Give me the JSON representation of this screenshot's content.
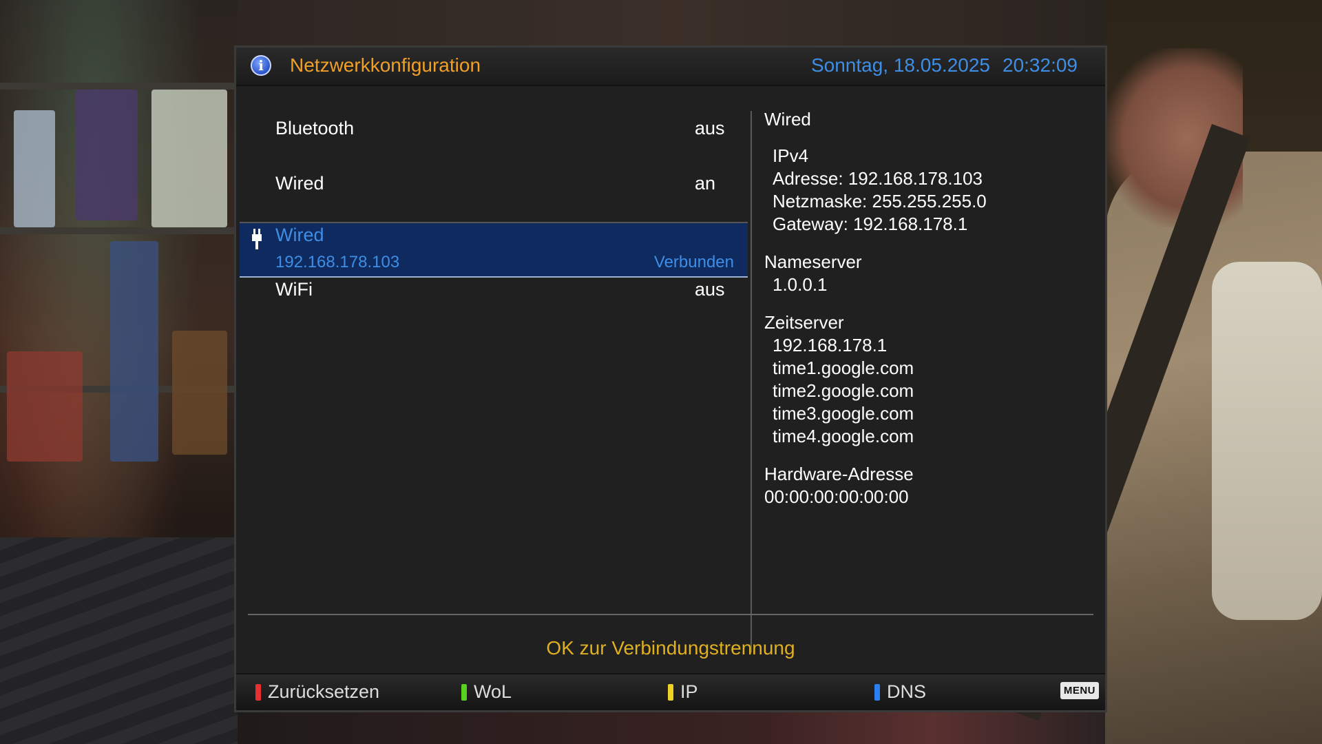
{
  "header": {
    "title": "Netzwerkkonfiguration",
    "date": "Sonntag, 18.05.2025",
    "time": "20:32:09",
    "info_icon": "info-icon"
  },
  "interfaces": {
    "bluetooth": {
      "label": "Bluetooth",
      "state": "aus"
    },
    "wired_toggle": {
      "label": "Wired",
      "state": "an"
    },
    "wired_connection": {
      "label": "Wired",
      "ip": "192.168.178.103",
      "status": "Verbunden",
      "icon": "ethernet-plug-icon"
    },
    "wifi": {
      "label": "WiFi",
      "state": "aus"
    }
  },
  "details": {
    "title": "Wired",
    "ipv4_heading": "IPv4",
    "address": "Adresse: 192.168.178.103",
    "netmask": "Netzmaske: 255.255.255.0",
    "gateway": "Gateway: 192.168.178.1",
    "nameserver_heading": "Nameserver",
    "nameservers": [
      "1.0.0.1"
    ],
    "timeserver_heading": "Zeitserver",
    "timeservers": [
      "192.168.178.1",
      "time1.google.com",
      "time2.google.com",
      "time3.google.com",
      "time4.google.com"
    ],
    "hw_heading": "Hardware-Adresse",
    "hw_address": "00:00:00:00:00:00"
  },
  "hint": "OK zur Verbindungstrennung",
  "keys": {
    "red": {
      "label": "Zurücksetzen",
      "color": "#e83030"
    },
    "green": {
      "label": "WoL",
      "color": "#5ad020"
    },
    "yellow": {
      "label": "IP",
      "color": "#f0d020"
    },
    "blue": {
      "label": "DNS",
      "color": "#2a80f0"
    },
    "menu": "MENU"
  },
  "colors": {
    "title": "#f0a028",
    "clock": "#3e8ee6",
    "selection_bg": "#0e2a5e",
    "hint": "#e0b020"
  }
}
